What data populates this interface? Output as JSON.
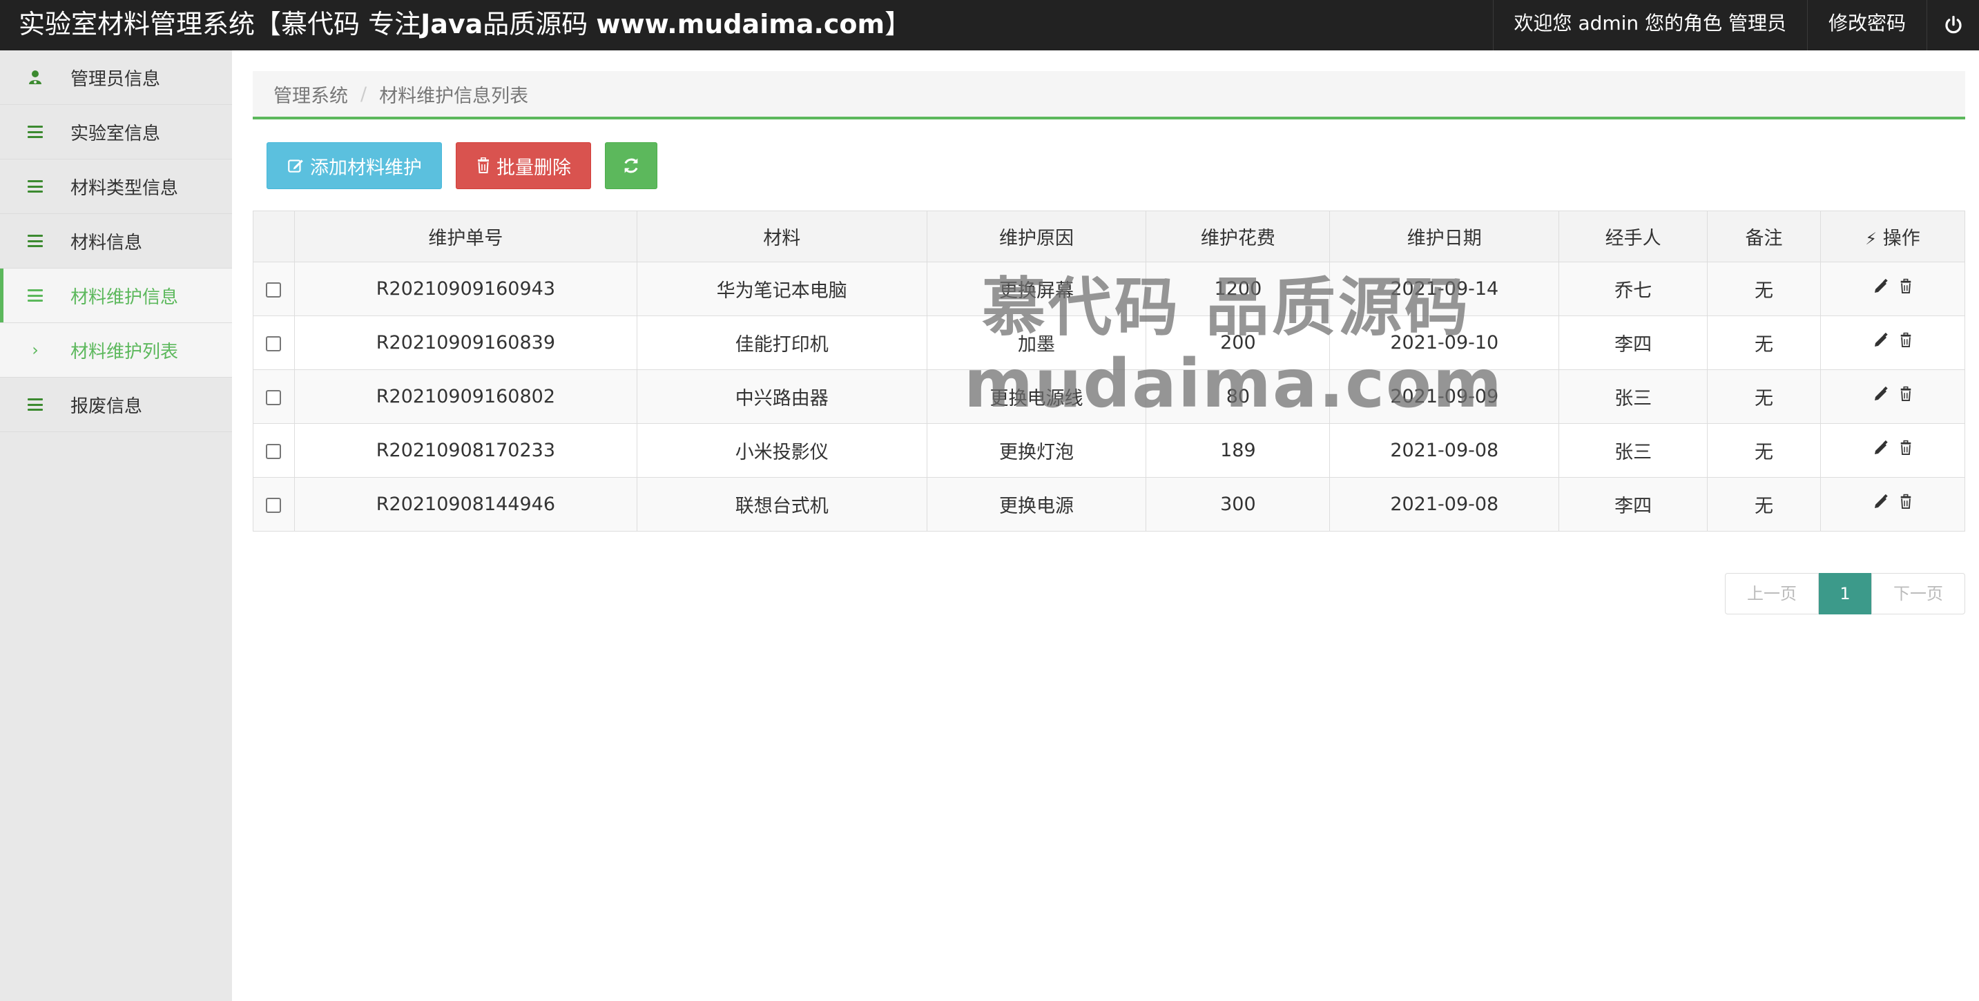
{
  "header": {
    "title_prefix": "实验室材料管理系统【慕代码 专注",
    "title_bold_1": "Java",
    "title_mid": "品质源码 ",
    "title_bold_2": "www.mudaima.com",
    "title_suffix": "】",
    "welcome": "欢迎您 admin 您的角色 管理员",
    "change_password": "修改密码",
    "logout_icon": "power-icon"
  },
  "sidebar": {
    "items": [
      {
        "label": "管理员信息",
        "icon": "user-icon"
      },
      {
        "label": "实验室信息",
        "icon": "list-icon"
      },
      {
        "label": "材料类型信息",
        "icon": "list-icon"
      },
      {
        "label": "材料信息",
        "icon": "list-icon"
      },
      {
        "label": "材料维护信息",
        "icon": "list-icon",
        "active": true
      },
      {
        "label": "材料维护列表",
        "icon": "chevron-right-icon",
        "sub": true
      },
      {
        "label": "报废信息",
        "icon": "list-icon"
      }
    ]
  },
  "breadcrumb": {
    "root": "管理系统",
    "sep": "/",
    "current": "材料维护信息列表"
  },
  "toolbar": {
    "add_label": "添加材料维护",
    "batch_delete_label": "批量删除",
    "refresh_icon": "refresh-icon"
  },
  "table": {
    "headers": [
      "维护单号",
      "材料",
      "维护原因",
      "维护花费",
      "维护日期",
      "经手人",
      "备注",
      "操作"
    ],
    "rows": [
      {
        "no": "R20210909160943",
        "material": "华为笔记本电脑",
        "reason": "更换屏幕",
        "cost": "1200",
        "date": "2021-09-14",
        "handler": "乔七",
        "note": "无"
      },
      {
        "no": "R20210909160839",
        "material": "佳能打印机",
        "reason": "加墨",
        "cost": "200",
        "date": "2021-09-10",
        "handler": "李四",
        "note": "无"
      },
      {
        "no": "R20210909160802",
        "material": "中兴路由器",
        "reason": "更换电源线",
        "cost": "80",
        "date": "2021-09-09",
        "handler": "张三",
        "note": "无"
      },
      {
        "no": "R20210908170233",
        "material": "小米投影仪",
        "reason": "更换灯泡",
        "cost": "189",
        "date": "2021-09-08",
        "handler": "张三",
        "note": "无"
      },
      {
        "no": "R20210908144946",
        "material": "联想台式机",
        "reason": "更换电源",
        "cost": "300",
        "date": "2021-09-08",
        "handler": "李四",
        "note": "无"
      }
    ]
  },
  "pagination": {
    "prev": "上一页",
    "current": "1",
    "next": "下一页"
  },
  "watermark": {
    "line1": "慕代码 品质源码",
    "line2": "mudaima.com"
  },
  "colors": {
    "topbar": "#222222",
    "accent": "#5cb85c",
    "info": "#5bc0de",
    "danger": "#d9534f",
    "pager_active": "#3c9a8a"
  }
}
